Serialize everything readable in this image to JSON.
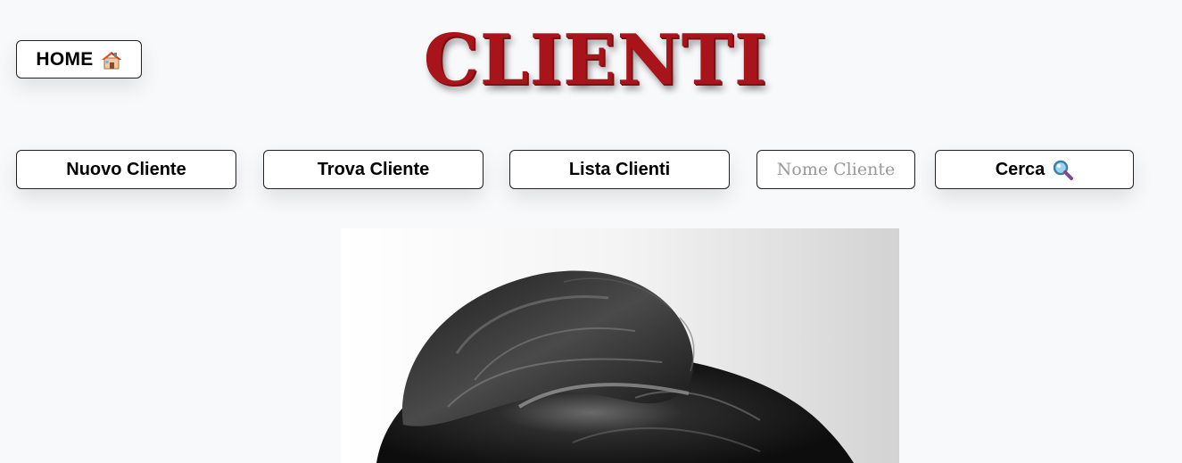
{
  "header": {
    "home_label": "HOME",
    "home_icon": "house-icon",
    "title": "CLIENTI",
    "title_color": "#a8141a"
  },
  "actions": {
    "new_client_label": "Nuovo Cliente",
    "find_client_label": "Trova Cliente",
    "list_clients_label": "Lista Clienti",
    "search_placeholder": "Nome Cliente",
    "search_value": "",
    "search_label": "Cerca",
    "search_icon": "magnifier-icon"
  },
  "photo": {
    "subject": "hair-bun-photo"
  }
}
